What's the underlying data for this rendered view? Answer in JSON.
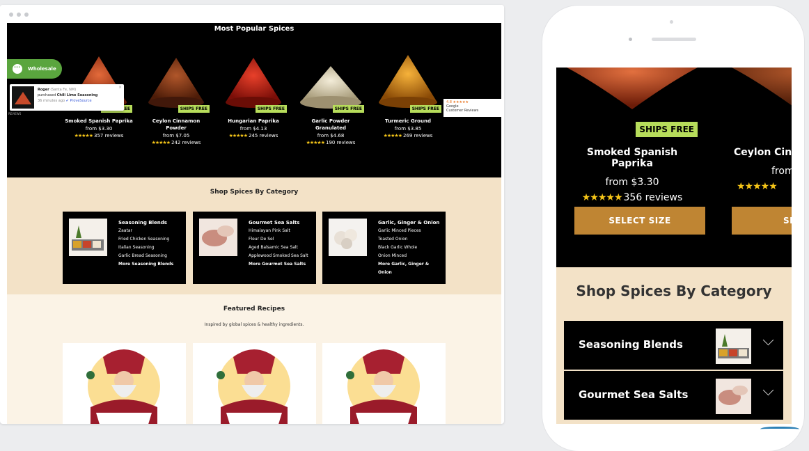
{
  "desktop": {
    "popular": {
      "title": "Most Popular Spices",
      "badge": "SHIPS FREE",
      "stars": "★★★★★",
      "products": [
        {
          "name": "Smoked Spanish Paprika",
          "price": "from $3.30",
          "reviews": "357 reviews",
          "color": "#c8441c"
        },
        {
          "name": "Ceylon Cinnamon Powder",
          "price": "from $7.05",
          "reviews": "242 reviews",
          "color": "#8a3c1b"
        },
        {
          "name": "Hungarian Paprika",
          "price": "from $4.13",
          "reviews": "245 reviews",
          "color": "#c41e15"
        },
        {
          "name": "Garlic Powder Granulated",
          "price": "from $4.68",
          "reviews": "190 reviews",
          "color": "#e5dcc2"
        },
        {
          "name": "Turmeric Ground",
          "price": "from $3.85",
          "reviews": "269 reviews",
          "color": "#e08a0e"
        }
      ]
    },
    "wholesale_label": "Wholesale",
    "proof_popup": {
      "name": "Roger",
      "location": "(Santa Fe, NM)",
      "action": "purchased",
      "product": "Chili Lime Seasoning",
      "time": "36 minutes ago",
      "source": "ProveSource",
      "close": "×"
    },
    "side_tag": "REVIEWS",
    "google_badge": {
      "rating": "4.8 ★★★★★",
      "name": "Google",
      "label": "Customer Reviews"
    },
    "categories": {
      "title": "Shop Spices By Category",
      "cards": [
        {
          "heading": "Seasoning Blends",
          "items": [
            "Zaatar",
            "Fried Chicken Seasoning",
            "Italian Seasoning",
            "Garlic Bread Seasoning"
          ],
          "more": "More Seasoning Blends"
        },
        {
          "heading": "Gourmet Sea Salts",
          "items": [
            "Himalayan Pink Salt",
            "Fleur De Sel",
            "Aged Balsamic Sea Salt",
            "Applewood Smoked Sea Salt"
          ],
          "more": "More Gourmet Sea Salts"
        },
        {
          "heading": "Garlic, Ginger & Onion",
          "items": [
            "Garlic Minced Pieces",
            "Toasted Onion",
            "Black Garlic Whole",
            "Onion Minced"
          ],
          "more": "More Garlic, Ginger & Onion"
        }
      ]
    },
    "recipes": {
      "title": "Featured Recipes",
      "subtitle": "Inspired by global spices & healthy ingredients."
    }
  },
  "mobile": {
    "badge": "SHIPS FREE",
    "stars": "★★★★★",
    "products": [
      {
        "name": "Smoked Spanish Paprika",
        "price": "from $3.30",
        "reviews": "356 reviews",
        "button": "SELECT SIZE"
      },
      {
        "name": "Ceylon Cinn",
        "price": "from",
        "reviews": "",
        "button": "SELE"
      }
    ],
    "categories": {
      "title": "Shop Spices By Category",
      "items": [
        "Seasoning Blends",
        "Gourmet Sea Salts"
      ]
    }
  },
  "colors": {
    "ships_free": "#b7dd5b",
    "select_button": "#bf8533",
    "category_bg": "#f3e2c7",
    "wholesale": "#5aa53e",
    "star": "#f5c518"
  },
  "icons": [
    "chat-bubble-icon",
    "star-icon",
    "chevron-down-icon",
    "verified-check-icon",
    "close-icon"
  ]
}
